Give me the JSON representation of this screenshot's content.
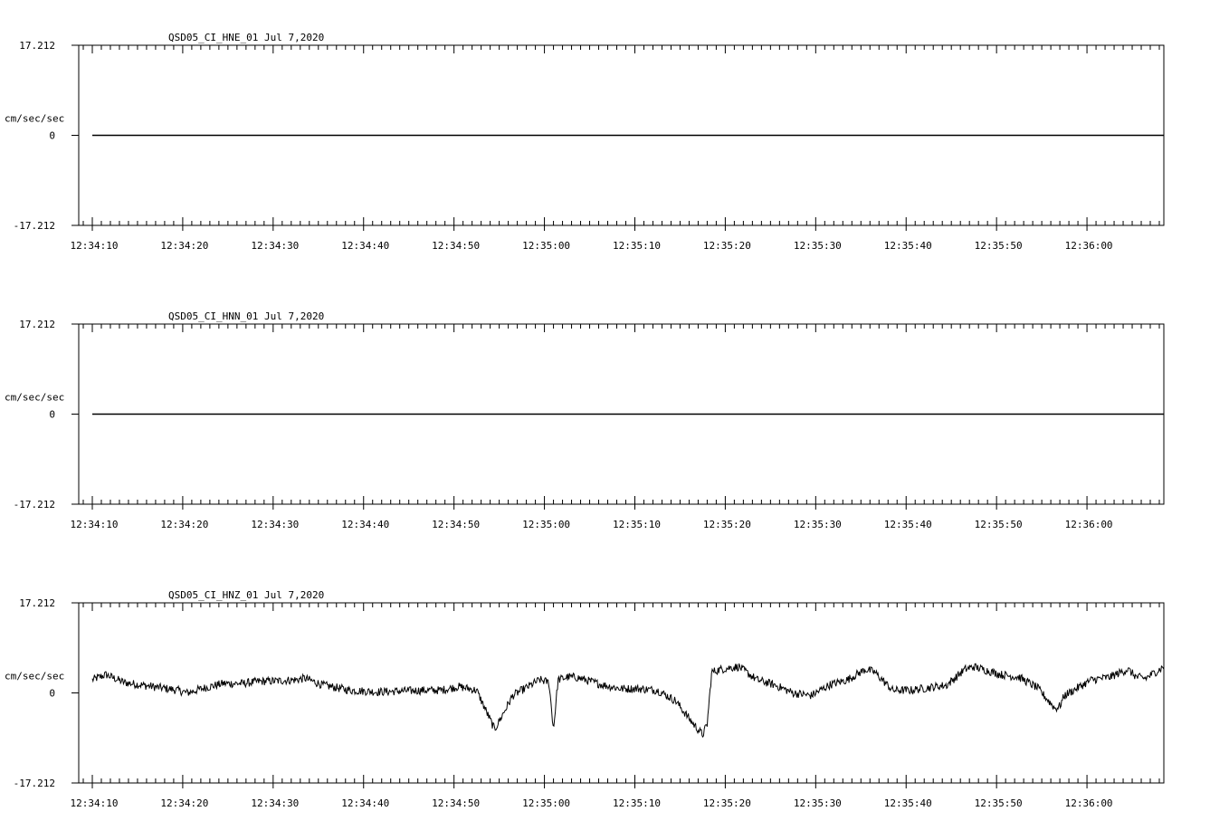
{
  "style": {
    "background": "#ffffff",
    "ink": "#000000"
  },
  "x_tick_labels": [
    "12:34:10",
    "12:34:20",
    "12:34:30",
    "12:34:40",
    "12:34:50",
    "12:35:00",
    "12:35:10",
    "12:35:20",
    "12:35:30",
    "12:35:40",
    "12:35:50",
    "12:36:00"
  ],
  "chart_data": [
    {
      "type": "line",
      "title": "QSD05_CI_HNE_01  Jul 7,2020",
      "ylabel": "cm/sec/sec",
      "y_tick_labels": [
        "17.212",
        "0",
        "-17.212"
      ],
      "ylim": [
        -17.212,
        17.212
      ],
      "x_start": "12:34:08.5",
      "x_end": "12:36:08.5",
      "x": [
        0.0,
        120.0
      ],
      "y": [
        0.0,
        0.0
      ],
      "series": [
        {
          "style": "flat",
          "x": [
            1.5,
            120.0
          ],
          "values": [
            0.0,
            0.0
          ]
        }
      ]
    },
    {
      "type": "line",
      "title": "QSD05_CI_HNN_01  Jul 7,2020",
      "ylabel": "cm/sec/sec",
      "y_tick_labels": [
        "17.212",
        "0",
        "-17.212"
      ],
      "ylim": [
        -17.212,
        17.212
      ],
      "x_start": "12:34:08.5",
      "x_end": "12:36:08.5",
      "series": [
        {
          "style": "flat",
          "x": [
            1.5,
            120.0
          ],
          "values": [
            0.0,
            0.0
          ]
        }
      ]
    },
    {
      "type": "line",
      "title": "QSD05_CI_HNZ_01  Jul 7,2020",
      "ylabel": "cm/sec/sec",
      "y_tick_labels": [
        "17.212",
        "0",
        "-17.212"
      ],
      "ylim": [
        -17.212,
        17.212
      ],
      "x_start": "12:34:08.5",
      "x_end": "12:36:08.5",
      "series": [
        {
          "style": "noisy",
          "x": [
            1.5,
            3.0,
            5.0,
            7.0,
            9.0,
            11.0,
            12.0,
            14.0,
            16.0,
            18.0,
            20.0,
            22.0,
            24.0,
            25.0,
            27.0,
            30.0,
            33.0,
            35.0,
            38.0,
            40.0,
            42.0,
            44.0,
            46.0,
            48.0,
            50.0,
            51.0,
            52.0,
            52.5,
            53.0,
            54.0,
            54.5,
            55.0,
            56.0,
            57.0,
            58.0,
            60.0,
            62.0,
            64.0,
            66.0,
            68.0,
            69.0,
            69.5,
            70.0,
            71.0,
            72.0,
            73.0,
            75.0,
            77.0,
            79.0,
            81.0,
            83.0,
            85.0,
            87.0,
            88.0,
            90.0,
            92.0,
            94.0,
            96.0,
            98.0,
            99.0,
            100.0,
            102.0,
            104.0,
            106.0,
            108.0,
            108.5,
            109.0,
            110.0,
            112.0,
            114.0,
            116.0,
            117.0,
            118.0,
            120.0
          ],
          "values": [
            2.5,
            3.5,
            2.0,
            1.5,
            1.0,
            0.5,
            0.0,
            1.0,
            1.8,
            1.8,
            2.2,
            2.3,
            2.5,
            2.8,
            1.5,
            0.5,
            0.2,
            0.3,
            0.5,
            0.5,
            1.2,
            0.5,
            -7.0,
            -0.5,
            1.5,
            2.5,
            2.0,
            -7.0,
            2.5,
            3.0,
            3.0,
            3.0,
            2.5,
            2.0,
            1.5,
            0.8,
            0.8,
            0.5,
            -1.5,
            -6.0,
            -8.0,
            -6.0,
            4.0,
            4.5,
            4.8,
            5.0,
            2.5,
            1.5,
            0.0,
            -0.5,
            1.5,
            2.5,
            4.5,
            4.0,
            0.5,
            0.5,
            1.0,
            1.5,
            4.5,
            5.0,
            4.5,
            3.5,
            3.0,
            1.0,
            -3.0,
            -2.5,
            -0.5,
            0.5,
            2.5,
            3.0,
            4.5,
            3.0,
            2.8,
            5.0
          ]
        }
      ]
    }
  ]
}
